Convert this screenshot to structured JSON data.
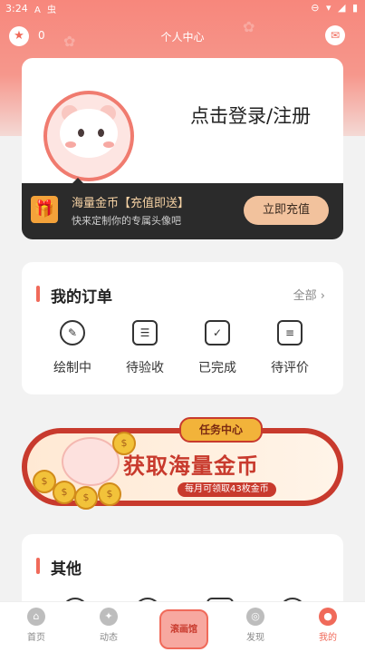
{
  "status_bar": {
    "time": "3:24",
    "left_icons": "A 虫",
    "right_icons": "⊖ ▾ ◢ ▮"
  },
  "header": {
    "title": "个人中心",
    "coin_count": "0"
  },
  "profile": {
    "login_text": "点击登录/注册",
    "recharge_title": "海量金币【充值即送】",
    "recharge_subtitle": "快来定制你的专属头像吧",
    "recharge_button": "立即充值"
  },
  "orders": {
    "title": "我的订单",
    "all_label": "全部 ›",
    "items": [
      {
        "label": "绘制中",
        "icon": "pen-circle-icon"
      },
      {
        "label": "待验收",
        "icon": "inspect-icon"
      },
      {
        "label": "已完成",
        "icon": "box-check-icon"
      },
      {
        "label": "待评价",
        "icon": "comment-icon"
      }
    ]
  },
  "banner": {
    "tag": "任务中心",
    "title": "获取海量金币",
    "subtitle": "每月可领取43枚金币"
  },
  "other": {
    "title": "其他"
  },
  "tabbar": {
    "items": [
      {
        "label": "首页"
      },
      {
        "label": "动态"
      },
      {
        "label": ""
      },
      {
        "label": "发现"
      },
      {
        "label": "我的"
      }
    ],
    "center_label": "滚画馆",
    "accent": "#f06a5a"
  }
}
